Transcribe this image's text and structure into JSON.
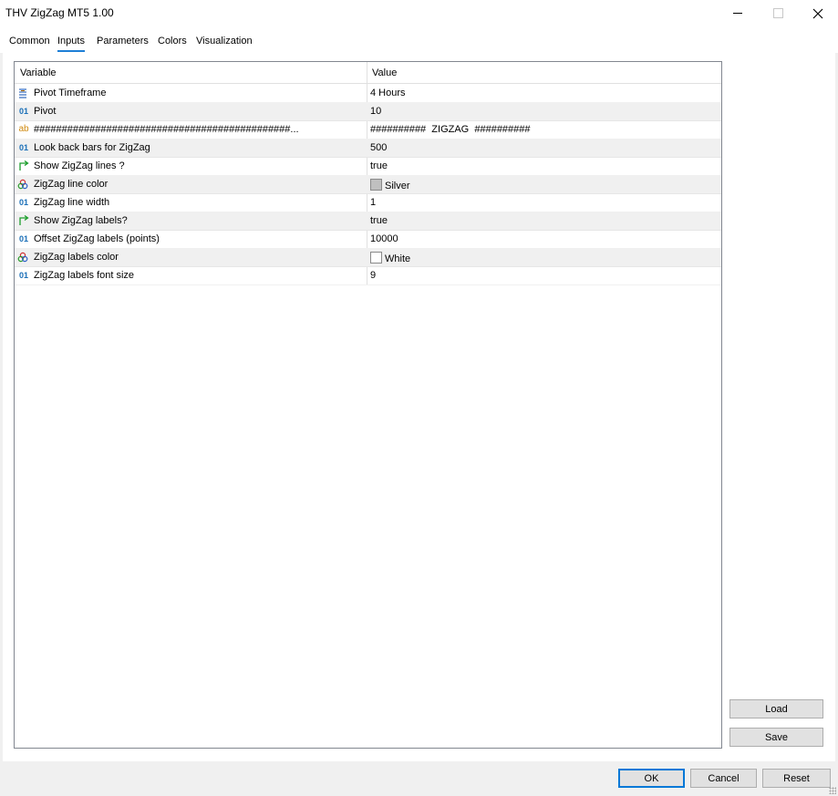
{
  "window": {
    "title": "THV ZigZag MT5 1.00",
    "controls": {
      "minimize_icon": "minimize-icon",
      "maximize_icon": "maximize-icon",
      "close_icon": "close-icon"
    }
  },
  "tabs": [
    {
      "label": "Common"
    },
    {
      "label": "Inputs",
      "active": true
    },
    {
      "label": "Parameters"
    },
    {
      "label": "Colors"
    },
    {
      "label": "Visualization"
    }
  ],
  "grid": {
    "headers": {
      "variable": "Variable",
      "value": "Value"
    },
    "rows": [
      {
        "icon": "enum-icon",
        "name": "Pivot Timeframe",
        "value": "4 Hours"
      },
      {
        "icon": "int-icon",
        "name": "Pivot",
        "value": "10"
      },
      {
        "icon": "string-icon",
        "name": "##############################################...",
        "value": "##########  ZIGZAG  ##########"
      },
      {
        "icon": "int-icon",
        "name": "Look back bars for ZigZag",
        "value": "500"
      },
      {
        "icon": "bool-icon",
        "name": "Show ZigZag lines ?",
        "value": "true"
      },
      {
        "icon": "color-icon",
        "name": "ZigZag line color",
        "value": "Silver",
        "swatch": "#c0c0c0"
      },
      {
        "icon": "int-icon",
        "name": "ZigZag line width",
        "value": "1"
      },
      {
        "icon": "bool-icon",
        "name": "Show ZigZag labels?",
        "value": "true"
      },
      {
        "icon": "int-icon",
        "name": "Offset ZigZag labels (points)",
        "value": "10000"
      },
      {
        "icon": "color-icon",
        "name": "ZigZag labels color",
        "value": "White",
        "swatch": "#ffffff"
      },
      {
        "icon": "int-icon",
        "name": "ZigZag labels font size",
        "value": "9"
      }
    ]
  },
  "side_buttons": {
    "load": "Load",
    "save": "Save"
  },
  "footer_buttons": {
    "ok": "OK",
    "cancel": "Cancel",
    "reset": "Reset"
  },
  "colors": {
    "accent": "#0078d7",
    "tab_underline": "#1e7fd6"
  }
}
